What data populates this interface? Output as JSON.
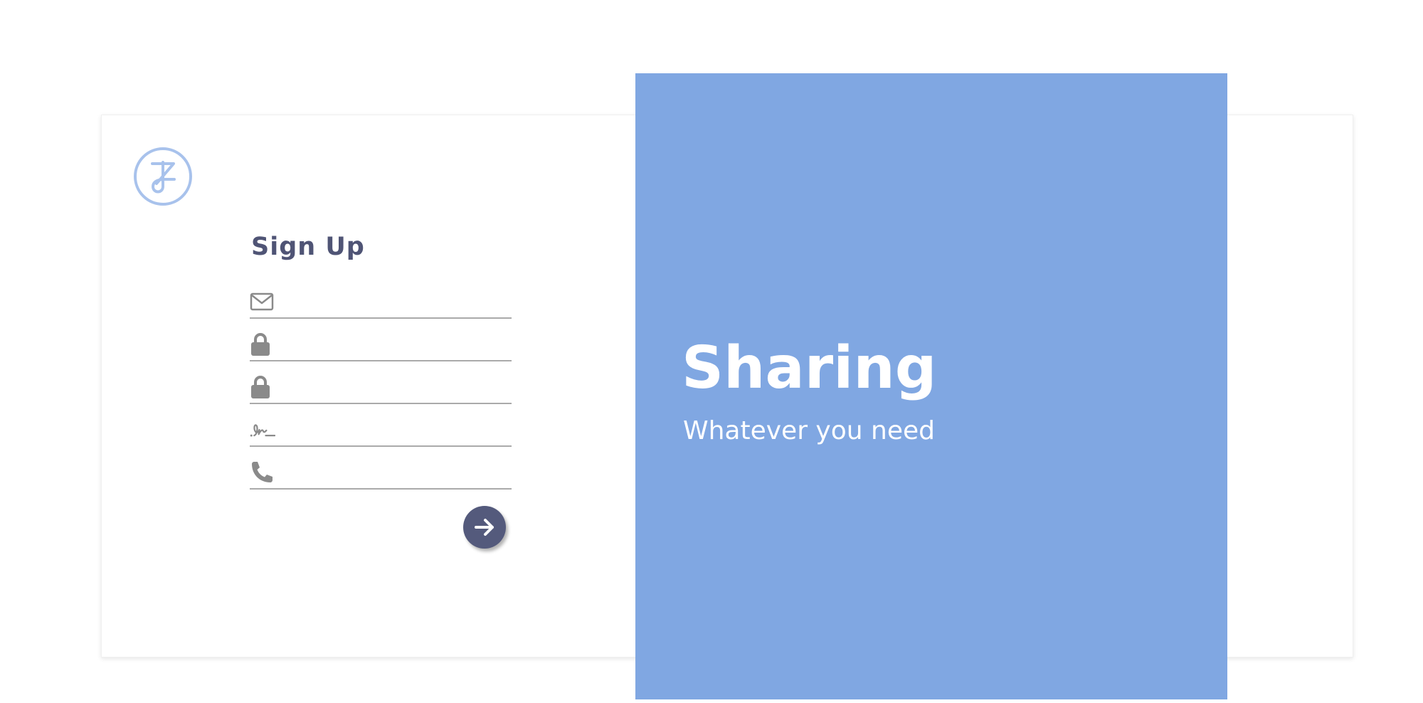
{
  "signup": {
    "title": "Sign Up",
    "fields": [
      {
        "icon": "envelope-icon",
        "value": "",
        "placeholder": ""
      },
      {
        "icon": "lock-icon",
        "value": "",
        "placeholder": ""
      },
      {
        "icon": "lock-icon",
        "value": "",
        "placeholder": ""
      },
      {
        "icon": "signature-icon",
        "value": "",
        "placeholder": ""
      },
      {
        "icon": "phone-icon",
        "value": "",
        "placeholder": ""
      }
    ],
    "submit_icon": "arrow-right-icon"
  },
  "logo": {
    "icon": "logo-icon"
  },
  "hero": {
    "title": "Sharing",
    "subtitle": "Whatever you need"
  },
  "colors": {
    "hero_background": "#80a7e2",
    "title_text": "#4f5475",
    "submit_button": "#545a7c",
    "logo_stroke": "#a8c2ec",
    "icon_gray": "#8a8a8a"
  }
}
